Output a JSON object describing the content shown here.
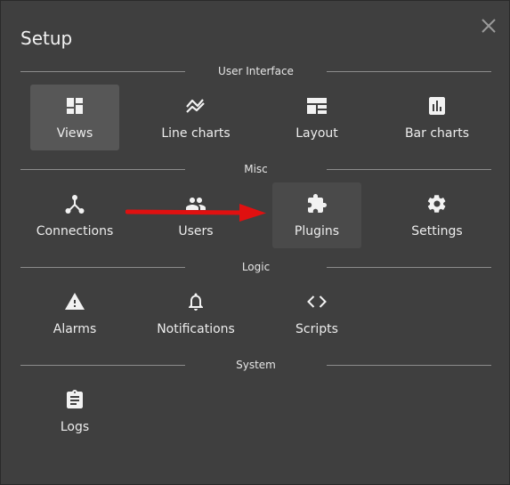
{
  "dialog": {
    "title": "Setup",
    "close_icon": "close-icon"
  },
  "sections": [
    {
      "heading": "User Interface",
      "items": [
        {
          "label": "Views",
          "icon": "dashboard-icon",
          "selected": true
        },
        {
          "label": "Line charts",
          "icon": "line-chart-icon"
        },
        {
          "label": "Layout",
          "icon": "layout-icon"
        },
        {
          "label": "Bar charts",
          "icon": "bar-chart-icon"
        }
      ]
    },
    {
      "heading": "Misc",
      "items": [
        {
          "label": "Connections",
          "icon": "connections-icon"
        },
        {
          "label": "Users",
          "icon": "users-icon"
        },
        {
          "label": "Plugins",
          "icon": "puzzle-icon",
          "hovered": true
        },
        {
          "label": "Settings",
          "icon": "gear-icon"
        }
      ]
    },
    {
      "heading": "Logic",
      "items": [
        {
          "label": "Alarms",
          "icon": "warning-icon"
        },
        {
          "label": "Notifications",
          "icon": "bell-icon"
        },
        {
          "label": "Scripts",
          "icon": "code-icon"
        }
      ]
    },
    {
      "heading": "System",
      "items": [
        {
          "label": "Logs",
          "icon": "clipboard-icon"
        }
      ]
    }
  ],
  "annotation": {
    "icon": "red-arrow",
    "color": "#e01010"
  },
  "colors": {
    "background": "#3f3f3f",
    "text": "#ededed",
    "selected_tile": "#575757",
    "divider": "#8c8c8c"
  }
}
